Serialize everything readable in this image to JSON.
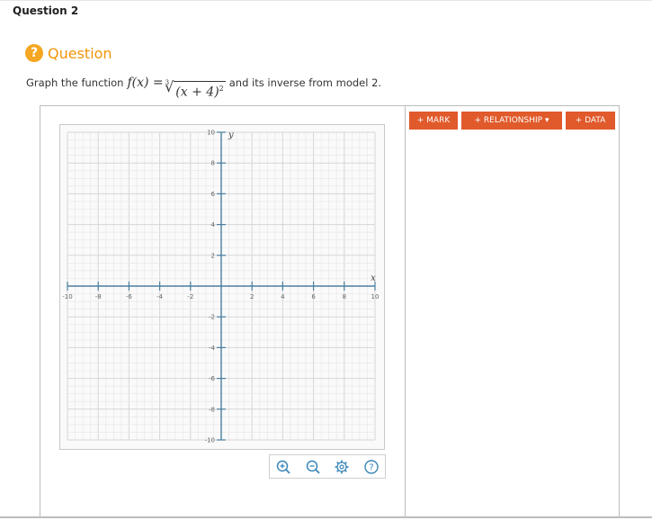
{
  "header": {
    "title": "Question 2"
  },
  "question": {
    "icon": "question-circle-icon",
    "label": "Question",
    "accent": "#f5a623"
  },
  "prompt": {
    "before": "Graph the function",
    "func": "f(x) = ",
    "radical_index": "3",
    "radicand": "(x + 4)",
    "exponent": "2",
    "after": "and its inverse from model 2."
  },
  "graph": {
    "x_axis_label": "x",
    "y_axis_label": "y",
    "x_ticks": [
      "-10",
      "-8",
      "-6",
      "-4",
      "-2",
      "2",
      "4",
      "6",
      "8",
      "10"
    ],
    "y_ticks": [
      "10",
      "8",
      "6",
      "4",
      "2",
      "-2",
      "-4",
      "-6",
      "-8",
      "-10"
    ],
    "x_range": [
      -10,
      10
    ],
    "y_range": [
      -10,
      10
    ],
    "axis_color": "#4a7fa0"
  },
  "toolbar": {
    "mark_label": "+ MARK",
    "relationship_label": "+ RELATIONSHIP ▾",
    "data_label": "+ DATA",
    "button_color": "#e05a2b",
    "tools": [
      "zoom-in-icon",
      "zoom-out-icon",
      "settings-icon",
      "help-icon"
    ]
  }
}
